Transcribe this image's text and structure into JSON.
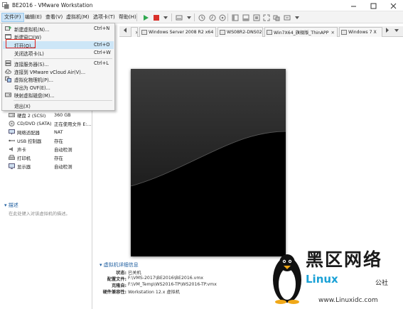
{
  "window": {
    "title": "BE2016 - VMware Workstation"
  },
  "menubar": {
    "items": [
      "文件(F)",
      "编辑(E)",
      "查看(V)",
      "虚拟机(M)",
      "选项卡(T)",
      "帮助(H)"
    ]
  },
  "file_menu": {
    "items": [
      {
        "label": "新建虚拟机(N)...",
        "shortcut": "Ctrl+N",
        "icon": "new-vm-icon"
      },
      {
        "label": "新建窗口(W)",
        "shortcut": "",
        "icon": "new-window-icon"
      },
      {
        "label": "打开(O)...",
        "shortcut": "Ctrl+O",
        "icon": ""
      },
      {
        "label": "关闭选项卡(L)",
        "shortcut": "Ctrl+W",
        "icon": ""
      },
      {
        "label": "连接服务器(S)...",
        "shortcut": "Ctrl+L",
        "icon": "connect-server-icon"
      },
      {
        "label": "连接到 VMware vCloud Air(V)...",
        "shortcut": "",
        "icon": "cloud-icon"
      },
      {
        "label": "虚拟化物理机(P)...",
        "shortcut": "",
        "icon": "virtualize-physical-icon"
      },
      {
        "label": "导出为 OVF(E)...",
        "shortcut": "",
        "icon": ""
      },
      {
        "label": "映射虚拟磁盘(M)...",
        "shortcut": "",
        "icon": "map-disk-icon"
      },
      {
        "label": "退出(X)",
        "shortcut": "",
        "icon": ""
      }
    ]
  },
  "tabs": [
    {
      "label": "Windows Server 2008 R2 x64"
    },
    {
      "label": "WS08R2-DNS02"
    },
    {
      "label": "Win7X64_旗舰版_ThinAPP"
    },
    {
      "label": "Windows 7 X"
    }
  ],
  "devices": [
    {
      "name": "硬盘 2 (SCSI)",
      "value": "360 GB",
      "icon": "hard-disk-icon"
    },
    {
      "name": "CD/DVD (SATA)",
      "value": "正在使用文件 E:...",
      "icon": "cd-dvd-icon"
    },
    {
      "name": "网络适配器",
      "value": "NAT",
      "icon": "network-adapter-icon"
    },
    {
      "name": "USB 控制器",
      "value": "存在",
      "icon": "usb-icon"
    },
    {
      "name": "声卡",
      "value": "自动检测",
      "icon": "sound-card-icon"
    },
    {
      "name": "打印机",
      "value": "存在",
      "icon": "printer-icon"
    },
    {
      "name": "显示器",
      "value": "自动检测",
      "icon": "display-icon"
    }
  ],
  "description": {
    "header": "描述",
    "placeholder": "在此处键入对该虚拟机的描述。"
  },
  "details": {
    "header": "虚拟机详细信息",
    "rows": [
      {
        "key": "状态:",
        "value": "已关机"
      },
      {
        "key": "配置文件:",
        "value": "F:\\VMS-2017\\BE2016\\BE2016.vmx"
      },
      {
        "key": "克隆自:",
        "value": "F:\\VM_Temp\\WS2016-TP\\WS2016-TP.vmx"
      },
      {
        "key": "硬件兼容性:",
        "value": "Workstation 12.x 虚拟机"
      }
    ]
  },
  "watermark": {
    "main": "黑区网络",
    "brand": "Linux",
    "sub": "公社",
    "url": "www.Linuxidc.com"
  },
  "colors": {
    "accent": "#1f5fa0",
    "highlight": "#cde6f7",
    "annotation_red": "#e0201c",
    "power_green": "#2fa84f",
    "stop_red": "#d9302a"
  }
}
